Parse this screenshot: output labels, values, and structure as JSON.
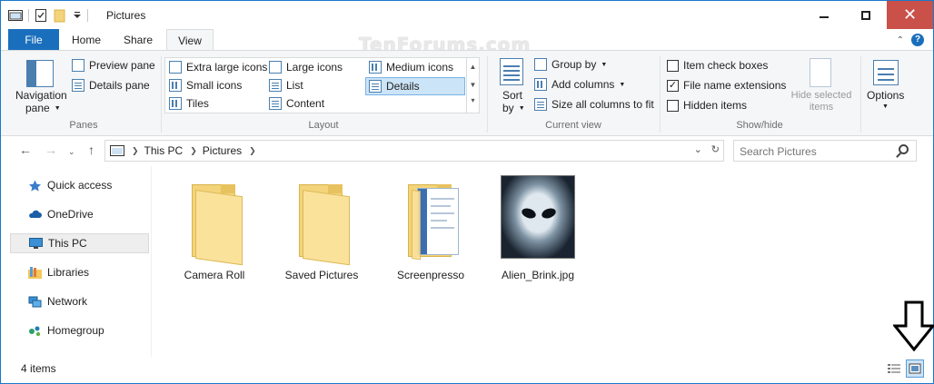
{
  "window": {
    "title": "Pictures",
    "colors": {
      "accent": "#1a6fbd",
      "close": "#c9514a",
      "selection": "#cce4f7"
    }
  },
  "watermark": "TenForums.com",
  "tabs": [
    {
      "label": "File"
    },
    {
      "label": "Home"
    },
    {
      "label": "Share"
    },
    {
      "label": "View"
    }
  ],
  "ribbon": {
    "panes": {
      "navigation_pane": "Navigation",
      "navigation_pane_2": "pane",
      "preview_pane": "Preview pane",
      "details_pane": "Details pane",
      "group_label": "Panes"
    },
    "layout": {
      "items": [
        "Extra large icons",
        "Large icons",
        "Medium icons",
        "Small icons",
        "List",
        "Details",
        "Tiles",
        "Content"
      ],
      "selected": "Details",
      "group_label": "Layout"
    },
    "current_view": {
      "sort_by_1": "Sort",
      "sort_by_2": "by",
      "group_by": "Group by",
      "add_columns": "Add columns",
      "size_columns": "Size all columns to fit",
      "group_label": "Current view"
    },
    "show_hide": {
      "item_check_boxes": {
        "label": "Item check boxes",
        "checked": false
      },
      "file_name_extensions": {
        "label": "File name extensions",
        "checked": true
      },
      "hidden_items": {
        "label": "Hidden items",
        "checked": false
      },
      "hide_selected_1": "Hide selected",
      "hide_selected_2": "items",
      "group_label": "Show/hide"
    },
    "options": "Options"
  },
  "address": {
    "crumbs": [
      "This PC",
      "Pictures"
    ],
    "search_placeholder": "Search Pictures"
  },
  "navpane": {
    "items": [
      {
        "label": "Quick access",
        "icon": "star-icon"
      },
      {
        "label": "OneDrive",
        "icon": "cloud-icon"
      },
      {
        "label": "This PC",
        "icon": "monitor-icon",
        "selected": true
      },
      {
        "label": "Libraries",
        "icon": "library-icon"
      },
      {
        "label": "Network",
        "icon": "network-icon"
      },
      {
        "label": "Homegroup",
        "icon": "homegroup-icon"
      }
    ]
  },
  "content": {
    "items": [
      {
        "label": "Camera Roll",
        "type": "folder"
      },
      {
        "label": "Saved Pictures",
        "type": "folder"
      },
      {
        "label": "Screenpresso",
        "type": "folder-with-doc"
      },
      {
        "label": "Alien_Brink.jpg",
        "type": "image"
      }
    ]
  },
  "status": {
    "count": "4 items"
  }
}
